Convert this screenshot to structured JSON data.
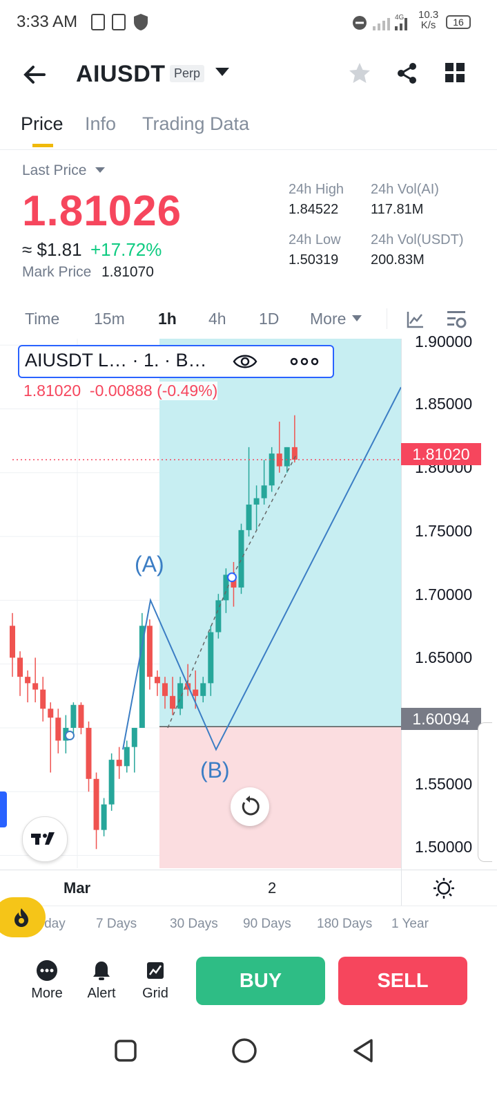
{
  "status_bar": {
    "time": "3:33 AM",
    "net_speed_value": "10.3",
    "net_speed_unit": "K/s",
    "network": "4G",
    "battery": "16"
  },
  "header": {
    "symbol": "AIUSDT",
    "contract_type": "Perp"
  },
  "tabs": [
    "Price",
    "Info",
    "Trading Data"
  ],
  "price": {
    "last_price_label": "Last Price",
    "last_price": "1.81026",
    "usd_approx": "≈ $1.81",
    "change_pct": "+17.72%",
    "mark_label": "Mark Price",
    "mark_price": "1.81070",
    "high_label": "24h High",
    "high": "1.84522",
    "low_label": "24h Low",
    "low": "1.50319",
    "vol_base_label": "24h Vol(AI)",
    "vol_base": "117.81M",
    "vol_quote_label": "24h Vol(USDT)",
    "vol_quote": "200.83M"
  },
  "timeframes": [
    "Time",
    "15m",
    "1h",
    "4h",
    "1D",
    "More"
  ],
  "chart": {
    "legend_text": "AIUSDT L… · 1. · B…",
    "ohlc_close": "1.81020",
    "ohlc_change": "-0.00888 (-0.49%)",
    "y_ticks": [
      "1.90000",
      "1.85000",
      "1.80000",
      "1.75000",
      "1.70000",
      "1.65000",
      "1.60000",
      "1.55000",
      "1.50000"
    ],
    "current_price_tag": "1.81020",
    "entry_price_tag": "1.60094",
    "x_labels": [
      "Mar",
      "2"
    ],
    "pattern_labels": [
      "(A)",
      "(B)"
    ],
    "colors": {
      "up": "#26a69a",
      "down": "#ef5350",
      "profit_zone": "#c7eef2",
      "loss_zone": "#fbdde0",
      "pattern_line": "#3b7dc4"
    }
  },
  "chart_data": {
    "type": "candlestick",
    "ylim": [
      1.49,
      1.905
    ],
    "y_ticks": [
      1.9,
      1.85,
      1.8,
      1.75,
      1.7,
      1.65,
      1.6,
      1.55,
      1.5
    ],
    "current_price": 1.8102,
    "entry_price": 1.60094,
    "candles": [
      {
        "o": 1.68,
        "h": 1.69,
        "l": 1.64,
        "c": 1.655
      },
      {
        "o": 1.655,
        "h": 1.66,
        "l": 1.625,
        "c": 1.64
      },
      {
        "o": 1.64,
        "h": 1.645,
        "l": 1.62,
        "c": 1.635
      },
      {
        "o": 1.635,
        "h": 1.655,
        "l": 1.62,
        "c": 1.63
      },
      {
        "o": 1.63,
        "h": 1.64,
        "l": 1.605,
        "c": 1.615
      },
      {
        "o": 1.615,
        "h": 1.62,
        "l": 1.565,
        "c": 1.608
      },
      {
        "o": 1.608,
        "h": 1.615,
        "l": 1.58,
        "c": 1.59
      },
      {
        "o": 1.59,
        "h": 1.61,
        "l": 1.58,
        "c": 1.6
      },
      {
        "o": 1.6,
        "h": 1.62,
        "l": 1.595,
        "c": 1.618
      },
      {
        "o": 1.618,
        "h": 1.62,
        "l": 1.595,
        "c": 1.6
      },
      {
        "o": 1.6,
        "h": 1.605,
        "l": 1.55,
        "c": 1.56
      },
      {
        "o": 1.56,
        "h": 1.565,
        "l": 1.505,
        "c": 1.52
      },
      {
        "o": 1.52,
        "h": 1.545,
        "l": 1.515,
        "c": 1.54
      },
      {
        "o": 1.54,
        "h": 1.58,
        "l": 1.535,
        "c": 1.575
      },
      {
        "o": 1.575,
        "h": 1.585,
        "l": 1.56,
        "c": 1.57
      },
      {
        "o": 1.57,
        "h": 1.59,
        "l": 1.565,
        "c": 1.585
      },
      {
        "o": 1.585,
        "h": 1.6,
        "l": 1.565,
        "c": 1.6
      },
      {
        "o": 1.6,
        "h": 1.69,
        "l": 1.6,
        "c": 1.68
      },
      {
        "o": 1.68,
        "h": 1.685,
        "l": 1.63,
        "c": 1.64
      },
      {
        "o": 1.64,
        "h": 1.645,
        "l": 1.625,
        "c": 1.635
      },
      {
        "o": 1.635,
        "h": 1.64,
        "l": 1.615,
        "c": 1.625
      },
      {
        "o": 1.625,
        "h": 1.64,
        "l": 1.61,
        "c": 1.615
      },
      {
        "o": 1.615,
        "h": 1.64,
        "l": 1.61,
        "c": 1.635
      },
      {
        "o": 1.635,
        "h": 1.65,
        "l": 1.625,
        "c": 1.63
      },
      {
        "o": 1.63,
        "h": 1.645,
        "l": 1.615,
        "c": 1.625
      },
      {
        "o": 1.625,
        "h": 1.64,
        "l": 1.62,
        "c": 1.635
      },
      {
        "o": 1.635,
        "h": 1.68,
        "l": 1.625,
        "c": 1.675
      },
      {
        "o": 1.675,
        "h": 1.705,
        "l": 1.67,
        "c": 1.7
      },
      {
        "o": 1.7,
        "h": 1.725,
        "l": 1.69,
        "c": 1.72
      },
      {
        "o": 1.72,
        "h": 1.73,
        "l": 1.695,
        "c": 1.71
      },
      {
        "o": 1.71,
        "h": 1.76,
        "l": 1.705,
        "c": 1.755
      },
      {
        "o": 1.755,
        "h": 1.82,
        "l": 1.75,
        "c": 1.775
      },
      {
        "o": 1.775,
        "h": 1.79,
        "l": 1.755,
        "c": 1.78
      },
      {
        "o": 1.78,
        "h": 1.81,
        "l": 1.775,
        "c": 1.79
      },
      {
        "o": 1.79,
        "h": 1.82,
        "l": 1.785,
        "c": 1.815
      },
      {
        "o": 1.815,
        "h": 1.84,
        "l": 1.8,
        "c": 1.805
      },
      {
        "o": 1.805,
        "h": 1.82,
        "l": 1.8,
        "c": 1.82
      },
      {
        "o": 1.82,
        "h": 1.845,
        "l": 1.808,
        "c": 1.8102
      }
    ]
  },
  "performance": [
    "Today",
    "7 Days",
    "30 Days",
    "90 Days",
    "180 Days",
    "1 Year"
  ],
  "bottom_nav": {
    "more": "More",
    "alert": "Alert",
    "grid": "Grid",
    "buy": "BUY",
    "sell": "SELL"
  }
}
